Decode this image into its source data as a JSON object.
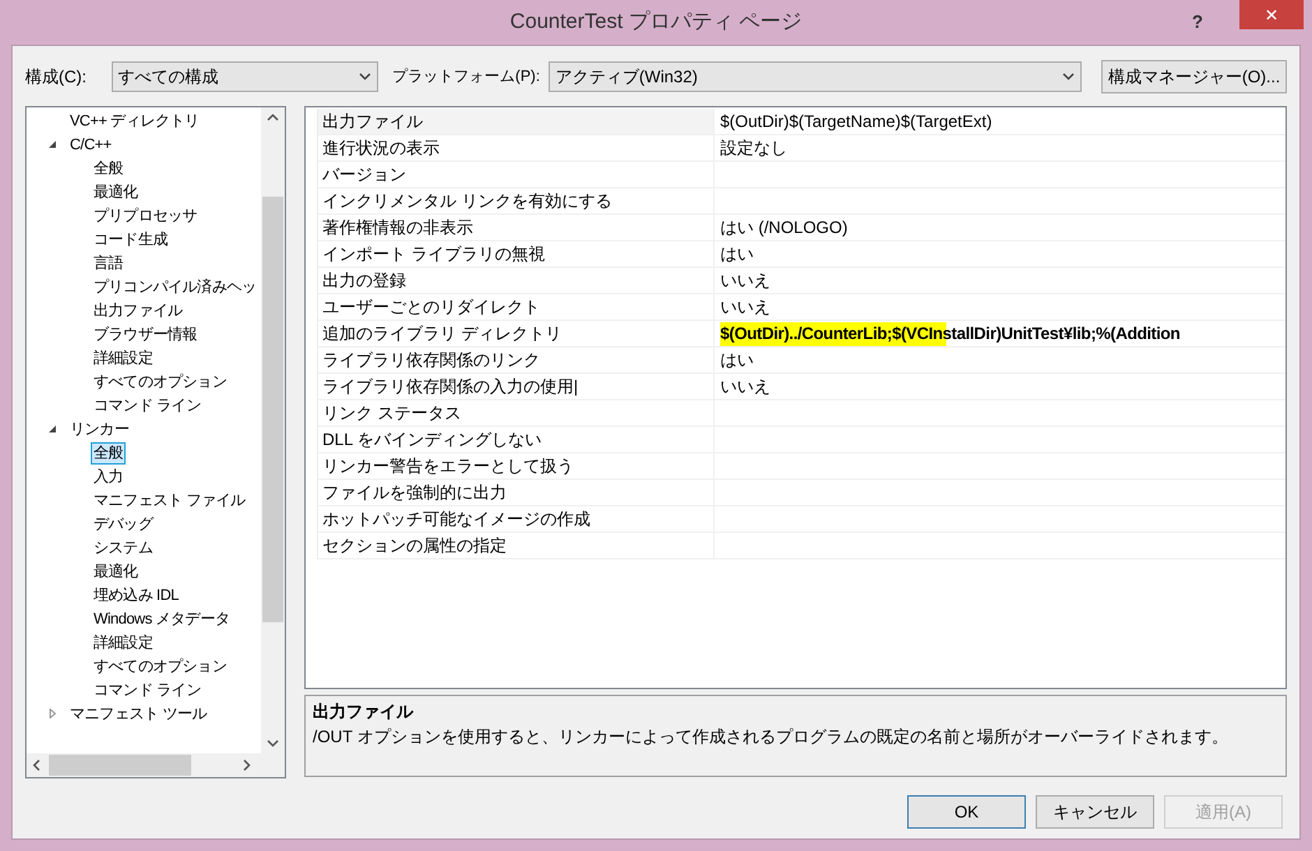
{
  "window": {
    "title": "CounterTest プロパティ ページ",
    "help": "?",
    "close": "✕"
  },
  "toolbar": {
    "configuration_label": "構成(C):",
    "configuration_value": "すべての構成",
    "platform_label": "プラットフォーム(P):",
    "platform_value": "アクティブ(Win32)",
    "manager_button": "構成マネージャー(O)..."
  },
  "tree": [
    {
      "label": "VC++ ディレクトリ",
      "selected": false
    },
    {
      "label": "C/C++",
      "selected": false,
      "expanded": true,
      "children": [
        {
          "label": "全般",
          "selected": false
        },
        {
          "label": "最適化",
          "selected": false
        },
        {
          "label": "プリプロセッサ",
          "selected": false
        },
        {
          "label": "コード生成",
          "selected": false
        },
        {
          "label": "言語",
          "selected": false
        },
        {
          "label": "プリコンパイル済みヘッ",
          "selected": false
        },
        {
          "label": "出力ファイル",
          "selected": false
        },
        {
          "label": "ブラウザー情報",
          "selected": false
        },
        {
          "label": "詳細設定",
          "selected": false
        },
        {
          "label": "すべてのオプション",
          "selected": false
        },
        {
          "label": "コマンド ライン",
          "selected": false
        }
      ]
    },
    {
      "label": "リンカー",
      "selected": false,
      "expanded": true,
      "children": [
        {
          "label": "全般",
          "selected": true
        },
        {
          "label": "入力",
          "selected": false
        },
        {
          "label": "マニフェスト ファイル",
          "selected": false
        },
        {
          "label": "デバッグ",
          "selected": false
        },
        {
          "label": "システム",
          "selected": false
        },
        {
          "label": "最適化",
          "selected": false
        },
        {
          "label": "埋め込み IDL",
          "selected": false
        },
        {
          "label": "Windows メタデータ",
          "selected": false
        },
        {
          "label": "詳細設定",
          "selected": false
        },
        {
          "label": "すべてのオプション",
          "selected": false
        },
        {
          "label": "コマンド ライン",
          "selected": false
        }
      ]
    },
    {
      "label": "マニフェスト ツール",
      "selected": false,
      "expanded": false
    }
  ],
  "properties": [
    {
      "name": "出力ファイル",
      "value": "$(OutDir)$(TargetName)$(TargetExt)",
      "selected": true,
      "bold": false,
      "highlighted": false
    },
    {
      "name": "進行状況の表示",
      "value": "設定なし",
      "selected": false,
      "bold": false,
      "highlighted": false
    },
    {
      "name": "バージョン",
      "selected": false
    },
    {
      "name": "インクリメンタル リンクを有効にする",
      "selected": false
    },
    {
      "name": "著作権情報の非表示",
      "value": "はい (/NOLOGO)",
      "selected": false,
      "bold": false,
      "highlighted": false
    },
    {
      "name": "インポート ライブラリの無視",
      "value": "はい",
      "selected": false,
      "bold": false,
      "highlighted": false
    },
    {
      "name": "出力の登録",
      "value": "いいえ",
      "selected": false,
      "bold": false,
      "highlighted": false
    },
    {
      "name": "ユーザーごとのリダイレクト",
      "value": "いいえ",
      "selected": false,
      "bold": false,
      "highlighted": false
    },
    {
      "name": "追加のライブラリ ディレクトリ",
      "value": "$(OutDir)../CounterLib;$(VCInstallDir)UnitTest¥lib;%(Addition",
      "selected": false,
      "bold": true,
      "highlighted": true
    },
    {
      "name": "ライブラリ依存関係のリンク",
      "value": "はい",
      "selected": false,
      "bold": false,
      "highlighted": false
    },
    {
      "name": "ライブラリ依存関係の入力の使用|",
      "value": "いいえ",
      "selected": false,
      "bold": false,
      "highlighted": false
    },
    {
      "name": "リンク ステータス",
      "selected": false
    },
    {
      "name": "DLL をバインディングしない",
      "selected": false
    },
    {
      "name": "リンカー警告をエラーとして扱う",
      "selected": false
    },
    {
      "name": "ファイルを強制的に出力",
      "selected": false
    },
    {
      "name": "ホットパッチ可能なイメージの作成",
      "selected": false
    },
    {
      "name": "セクションの属性の指定",
      "selected": false
    }
  ],
  "description": {
    "title": "出力ファイル",
    "text": "/OUT オプションを使用すると、リンカーによって作成されるプログラムの既定の名前と場所がオーバーライドされます。"
  },
  "buttons": [
    {
      "label": "OK",
      "disabled": false,
      "default": true
    },
    {
      "label": "キャンセル",
      "disabled": false,
      "default": false
    },
    {
      "label": "適用(A)",
      "disabled": true,
      "default": false
    }
  ]
}
